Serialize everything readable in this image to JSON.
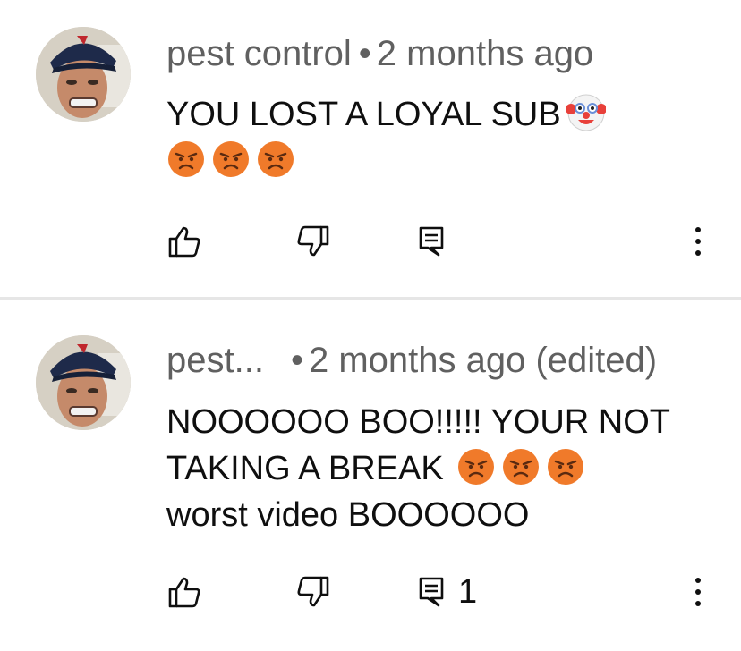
{
  "comments": [
    {
      "author": "pest control",
      "separator": "•",
      "time": "2 months ago",
      "lines": [
        "YOU LOST A  LOYAL SUB"
      ],
      "emojis_line1": [
        "clown-face-emoji"
      ],
      "emojis_line2": [
        "angry-face-emoji",
        "angry-face-emoji",
        "angry-face-emoji"
      ],
      "reply_count": ""
    },
    {
      "author": "pest...",
      "separator": "•",
      "time": "2 months ago (edited)",
      "lines": [
        "NOOOOOO BOO!!!!! YOUR NOT",
        "TAKING A BREAK",
        "worst video BOOOOOO"
      ],
      "emojis_line2": [
        "angry-face-emoji",
        "angry-face-emoji",
        "angry-face-emoji"
      ],
      "reply_count": "1"
    }
  ],
  "icons": {
    "like": "thumbs-up-icon",
    "dislike": "thumbs-down-icon",
    "reply": "reply-comment-icon",
    "more": "more-vertical-icon"
  },
  "colors": {
    "meta_text": "#606060",
    "body_text": "#0f0f0f",
    "divider": "#e6e6e6",
    "angry_emoji": "#f07a2a"
  }
}
